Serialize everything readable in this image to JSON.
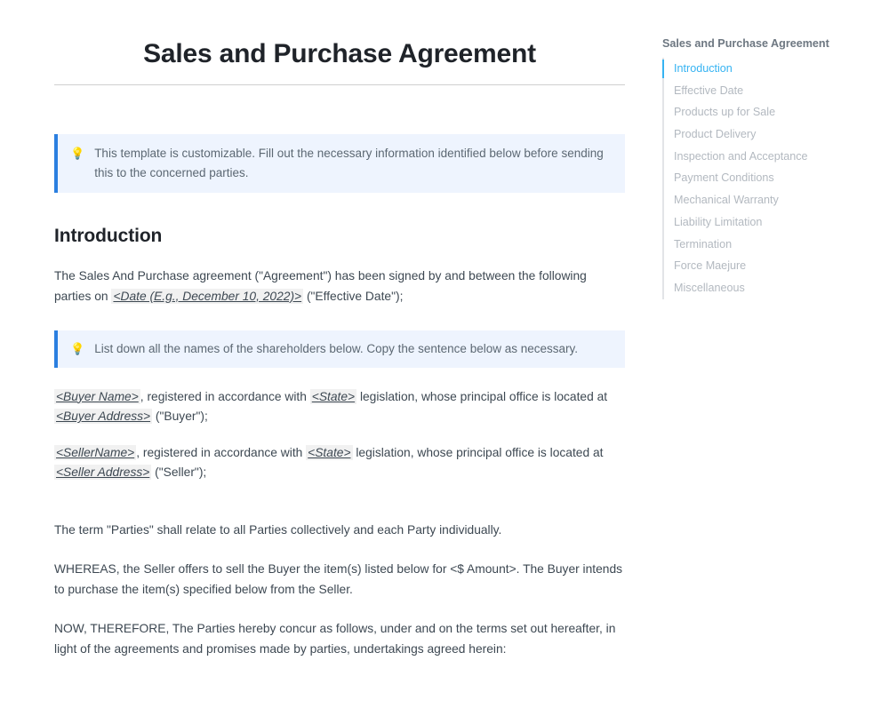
{
  "document": {
    "title": "Sales and Purchase Agreement",
    "callouts": [
      {
        "icon": "lightbulb-emoji",
        "text": "This template is customizable. Fill out the necessary information identified below before sending this to the concerned parties."
      },
      {
        "icon": "lightbulb-emoji",
        "text": "List down all the names of the shareholders below. Copy the sentence below as necessary."
      }
    ],
    "section_heading": "Introduction",
    "paragraphs": {
      "intro_part1": "The Sales And Purchase agreement (\"Agreement\") has been signed by and between the following parties on ",
      "intro_date_placeholder": "<Date (E.g., December 10, 2022)>",
      "intro_part2": " (\"Effective Date\");",
      "buyer_name_placeholder": "<Buyer Name>",
      "buyer_mid1": ", registered in accordance with ",
      "buyer_state_placeholder": "<State>",
      "buyer_mid2": " legislation, whose principal office is located at ",
      "buyer_address_placeholder": "<Buyer Address>",
      "buyer_tail": " (\"Buyer\");",
      "seller_name_placeholder": "<SellerName>",
      "seller_mid1": ", registered in accordance with ",
      "seller_state_placeholder": "<State>",
      "seller_mid2": " legislation, whose principal office is located at ",
      "seller_address_placeholder": "<Seller Address>",
      "seller_tail": " (\"Seller\");",
      "parties": "The term \"Parties\" shall relate to all Parties collectively and each Party individually.",
      "whereas": "WHEREAS, the Seller offers to sell the Buyer the item(s) listed below for <$ Amount>. The Buyer intends to purchase the item(s) specified below from the Seller.",
      "now_therefore": "NOW, THEREFORE, The Parties hereby concur as follows, under and on the terms set out hereafter, in light of the agreements and promises made by parties, undertakings agreed herein:"
    }
  },
  "sidebar": {
    "title": "Sales and Purchase Agreement",
    "active_color": "#36b3f2",
    "inactive_color": "#b3b9c0",
    "items": [
      {
        "label": "Introduction",
        "active": true
      },
      {
        "label": "Effective Date",
        "active": false
      },
      {
        "label": "Products up for Sale",
        "active": false
      },
      {
        "label": "Product Delivery",
        "active": false
      },
      {
        "label": "Inspection and Acceptance",
        "active": false
      },
      {
        "label": "Payment Conditions",
        "active": false
      },
      {
        "label": "Mechanical Warranty",
        "active": false
      },
      {
        "label": "Liability Limitation",
        "active": false
      },
      {
        "label": "Termination",
        "active": false
      },
      {
        "label": "Force Maejure",
        "active": false
      },
      {
        "label": "Miscellaneous",
        "active": false
      }
    ]
  }
}
